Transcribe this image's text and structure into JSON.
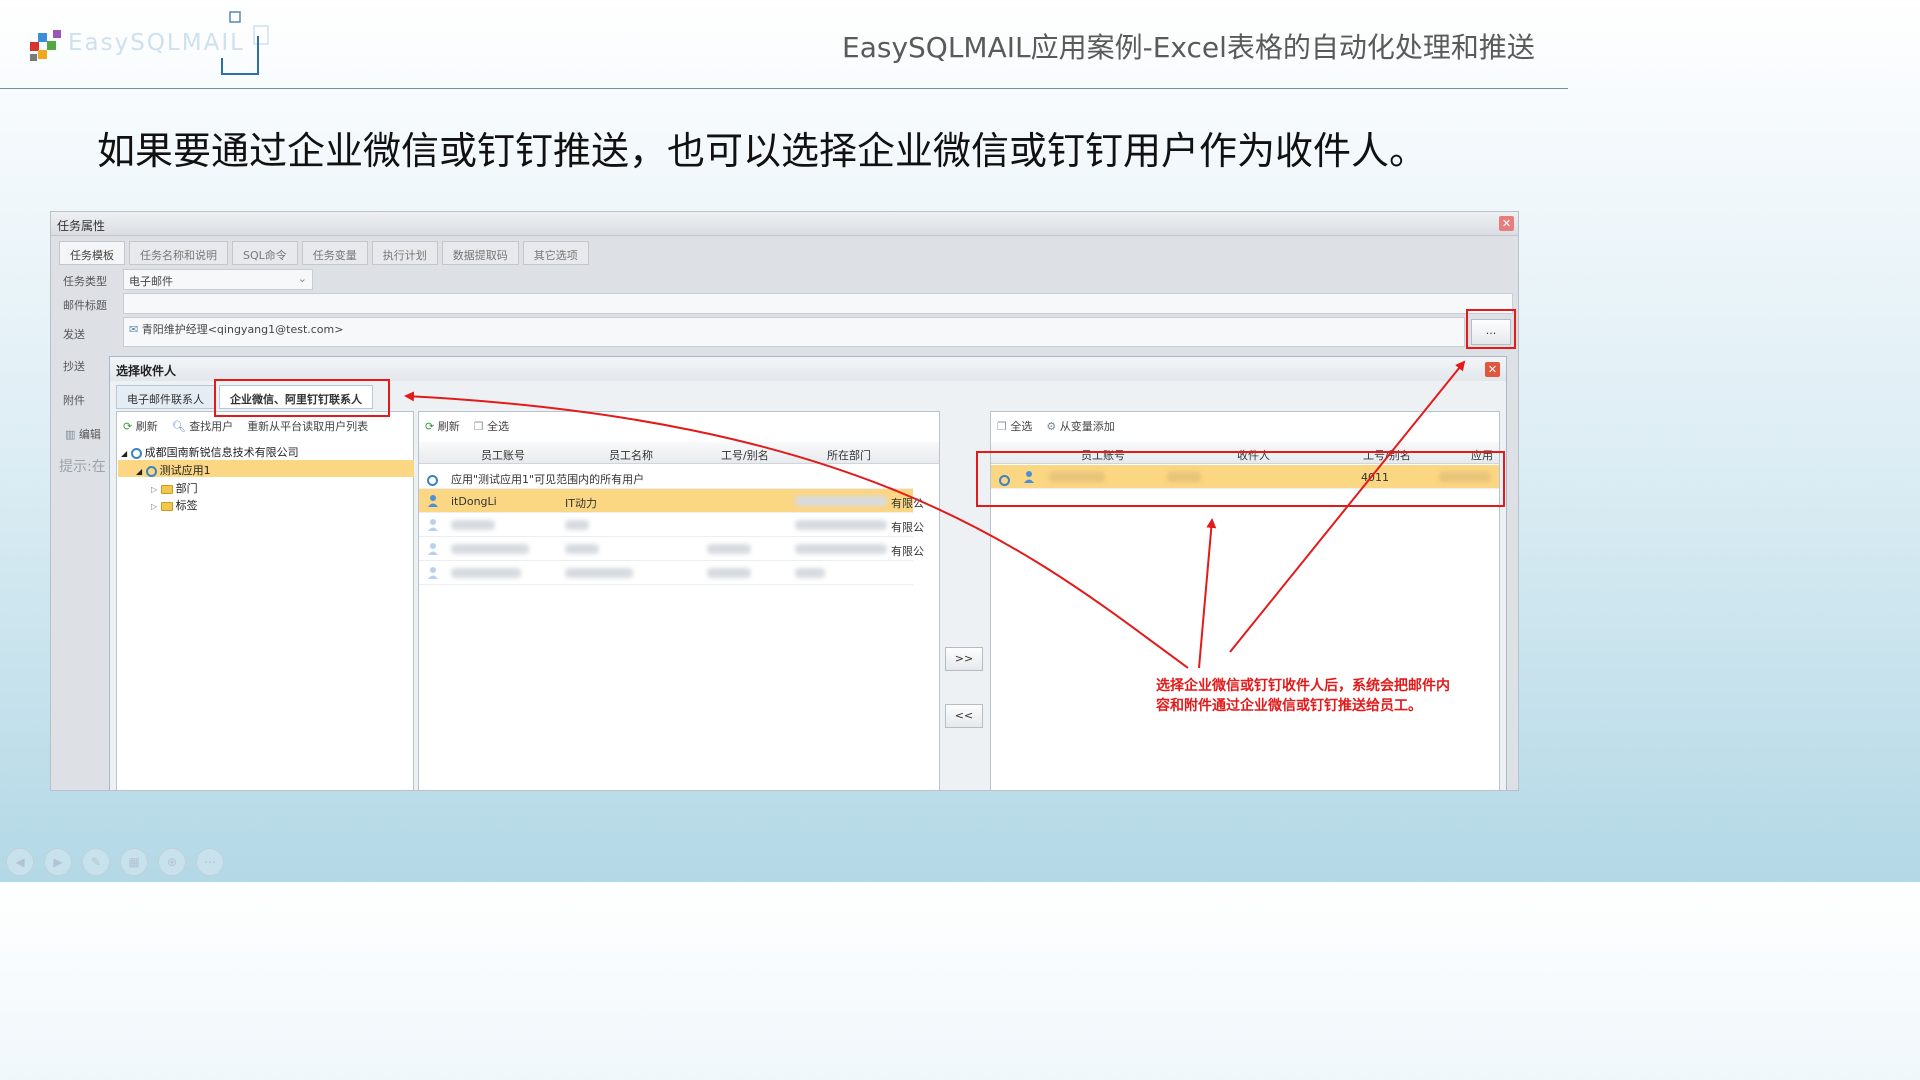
{
  "header": {
    "logo_text": "EasySQLMAIL",
    "title": "EasySQLMAIL应用案例-Excel表格的自动化处理和推送"
  },
  "subtitle": "如果要通过企业微信或钉钉推送，也可以选择企业微信或钉钉用户作为收件人。",
  "task_window": {
    "title": "任务属性",
    "tabs": [
      "任务模板",
      "任务名称和说明",
      "SQL命令",
      "任务变量",
      "执行计划",
      "数据提取码",
      "其它选项"
    ],
    "labels": {
      "task_type": "任务类型",
      "mail_subject": "邮件标题",
      "send": "发送",
      "cc": "抄送",
      "attachment": "附件",
      "edit": "编辑",
      "hint": "提示:在"
    },
    "task_type_value": "电子邮件",
    "send_value": "青阳维护经理<qingyang1@test.com>",
    "browse_label": "..."
  },
  "recipient_dialog": {
    "title": "选择收件人",
    "tabs": [
      "电子邮件联系人",
      "企业微信、阿里钉钉联系人"
    ],
    "left_toolbar": {
      "refresh": "刷新",
      "find_user": "查找用户",
      "reload": "重新从平台读取用户列表"
    },
    "tree": {
      "company": "成都国南新锐信息技术有限公司",
      "app": "测试应用1",
      "children": [
        "部门",
        "标签"
      ]
    },
    "middle_toolbar": {
      "refresh": "刷新",
      "select_all": "全选"
    },
    "middle_columns": [
      "员工账号",
      "员工名称",
      "工号/别名",
      "所在部门"
    ],
    "middle_rows": [
      {
        "text": "应用\"测试应用1\"可见范围内的所有用户"
      },
      {
        "account": "itDongLi",
        "name": "IT动力",
        "dept_suffix": "有限公"
      },
      {
        "dept_suffix": "有限公"
      },
      {
        "dept_suffix": "有限公"
      }
    ],
    "move_buttons": {
      "add": ">>",
      "remove": "<<"
    },
    "right_toolbar": {
      "select_all": "全选",
      "add_from_var": "从变量添加"
    },
    "right_columns": [
      "员工账号",
      "收件人",
      "工号/别名",
      "应用"
    ],
    "right_rows": [
      {
        "alias": "4011"
      }
    ]
  },
  "annotation": "选择企业微信或钉钉收件人后，系统会把邮件内容和附件通过企业微信或钉钉推送给员工。",
  "colors": {
    "accent_red": "#e21a1a",
    "highlight_row": "#fbd683",
    "header_line": "#6f8fa8"
  }
}
